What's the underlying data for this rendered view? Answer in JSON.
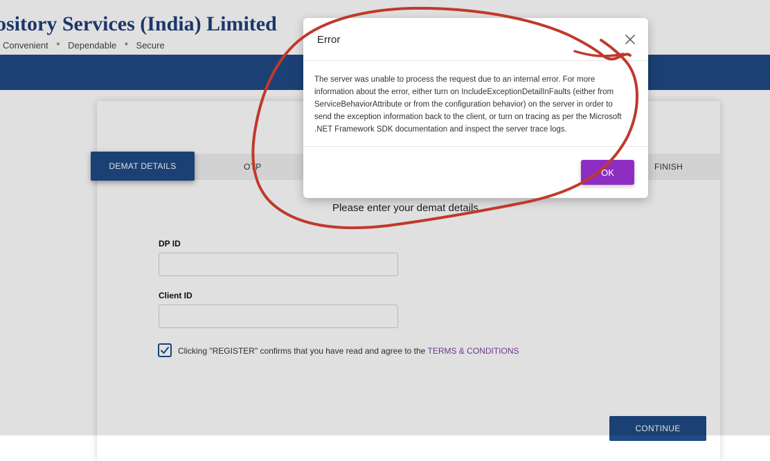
{
  "header": {
    "brand_title": "ository Services (India) Limited",
    "tagline": [
      "Convenient",
      "*",
      "Dependable",
      "*",
      "Secure"
    ]
  },
  "steps": {
    "active": "DEMAT DETAILS",
    "otp": "OTP",
    "finish": "FINISH"
  },
  "form": {
    "instruction": "Please enter your demat details.",
    "dp_id_label": "DP ID",
    "client_id_label": "Client ID",
    "consent_text": "Clicking \"REGISTER\" confirms that you have read and agree to the ",
    "consent_link": "TERMS & CONDITIONS",
    "checkbox_checked": true,
    "continue_label": "CONTINUE"
  },
  "modal": {
    "title": "Error",
    "message": "The server was unable to process the request due to an internal error. For more information about the error, either turn on IncludeExceptionDetailInFaults (either from ServiceBehaviorAttribute or from the configuration behavior) on the server in order to send the exception information back to the client, or turn on tracing as per the Microsoft .NET Framework SDK documentation and inspect the server trace logs.",
    "ok_label": "OK"
  },
  "colors": {
    "brand_navy": "#1f4a84",
    "ok_purple": "#8e2dc2",
    "annotation_red": "#c0392b"
  },
  "icons": {
    "close": "close-icon",
    "checkmark": "checkmark-icon"
  }
}
